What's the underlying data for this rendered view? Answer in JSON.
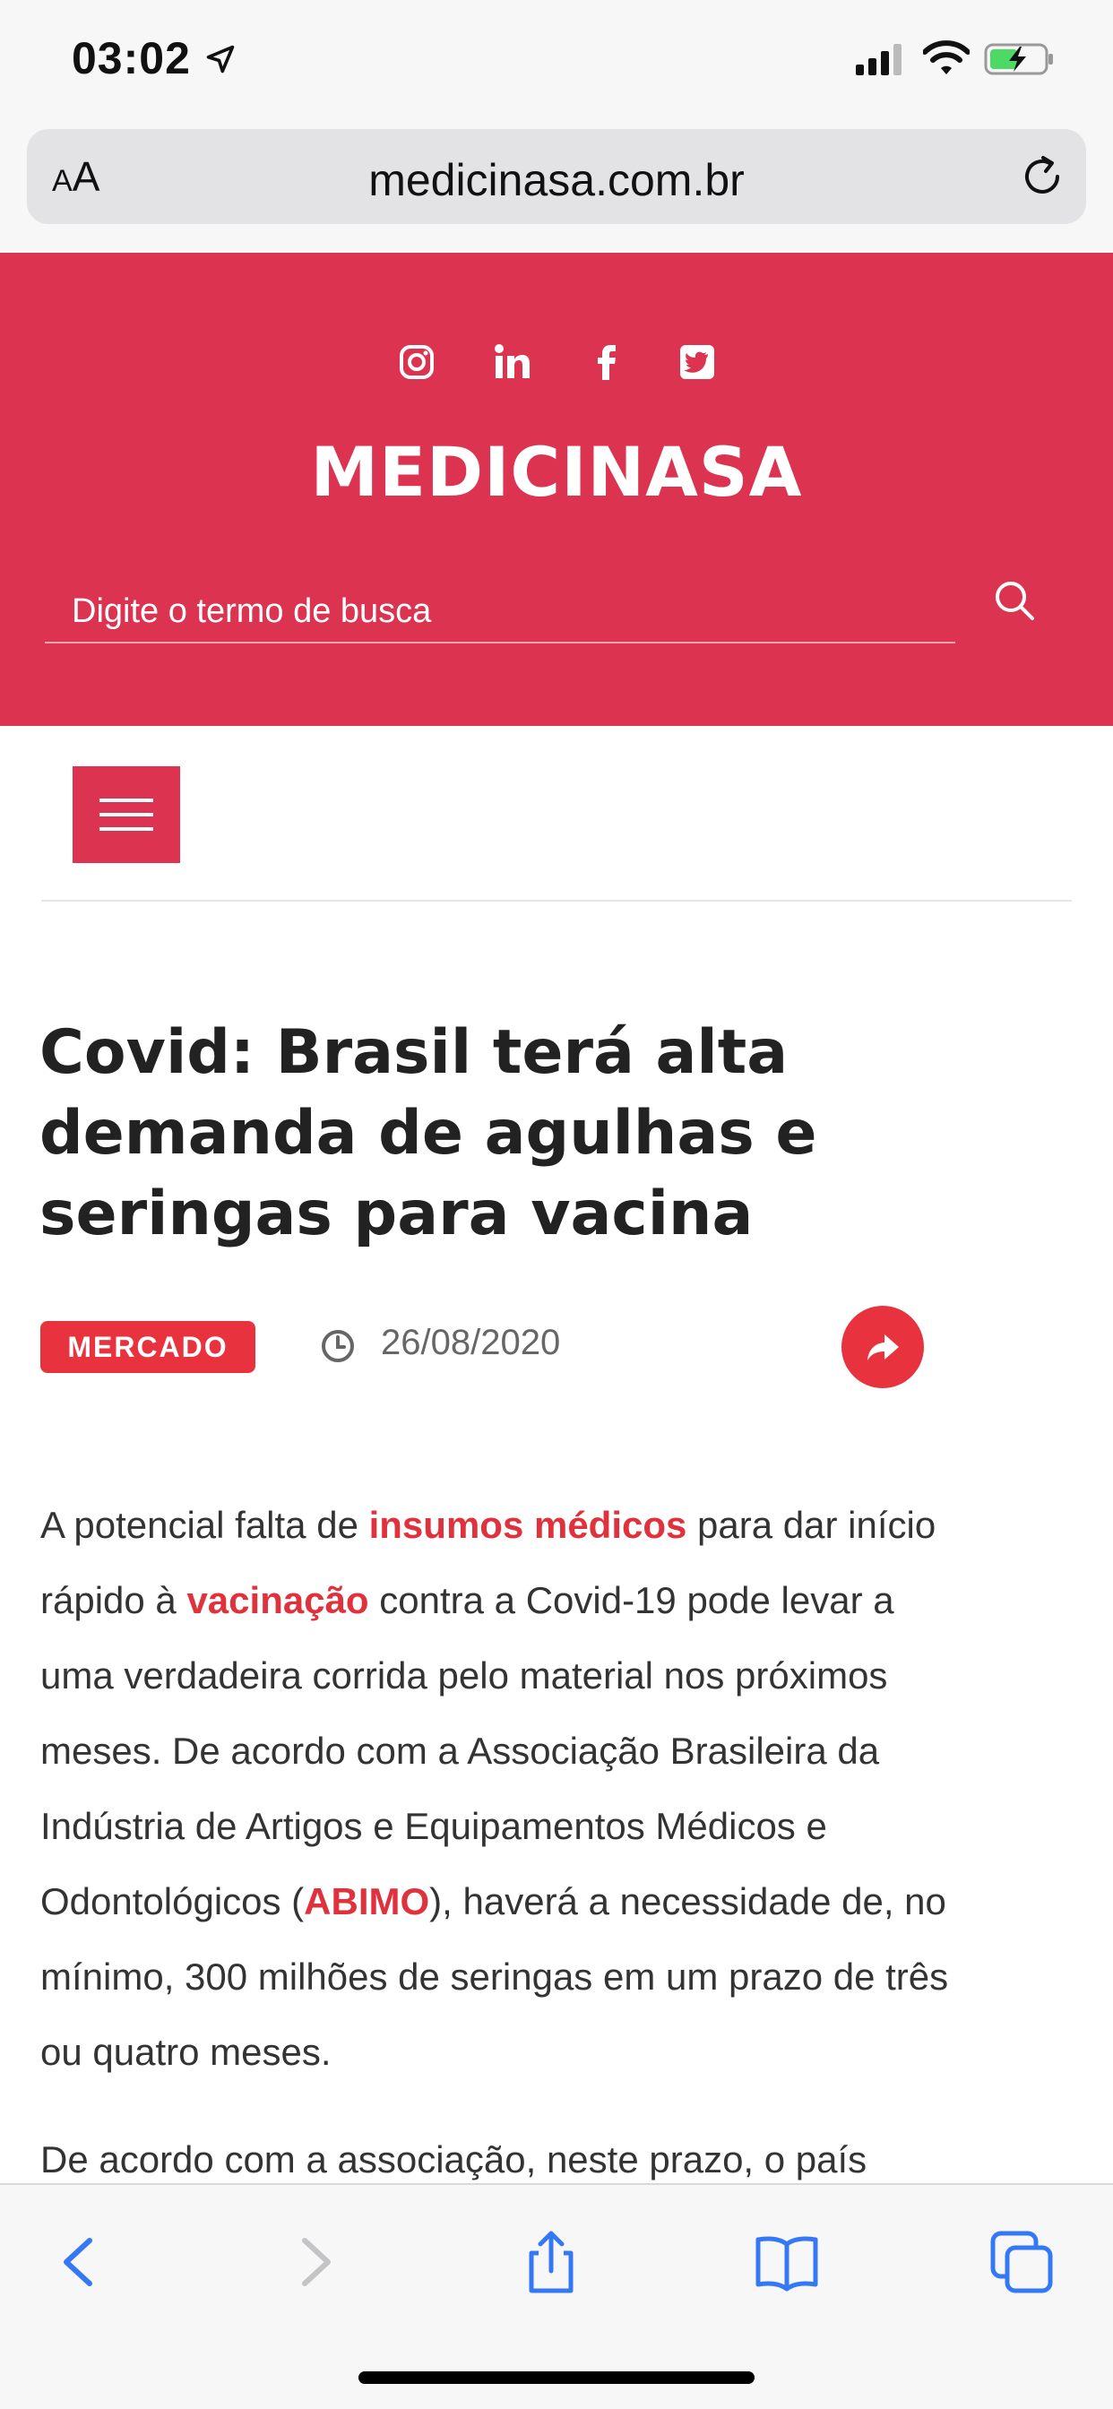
{
  "status_bar": {
    "time": "03:02",
    "icons": [
      "location-arrow-icon",
      "cellular-signal-icon",
      "wifi-icon",
      "battery-charging-icon"
    ]
  },
  "browser": {
    "text_size_label_small": "A",
    "text_size_label_large": "A",
    "url": "medicinasa.com.br",
    "reload_icon": "reload-icon"
  },
  "site": {
    "social_icons": [
      "instagram-icon",
      "linkedin-icon",
      "facebook-icon",
      "twitter-icon"
    ],
    "logo": "MEDICINASA",
    "search_placeholder": "Digite o termo de busca",
    "accent_color": "#dc3350"
  },
  "article": {
    "headline_lines": [
      "Covid: Brasil terá alta",
      "demanda de agulhas e",
      "seringas para vacina"
    ],
    "category": "MERCADO",
    "date": "26/08/2020",
    "paragraph1": {
      "p1": "A potencial falta de ",
      "link1": "insumos médicos",
      "p2": " para dar início rápido à ",
      "link2": "vacinação",
      "p3": " contra a Covid-19 pode levar a uma verdadeira corrida pelo material nos próximos meses. De acordo com a Associação Brasileira da Indústria de Artigos e Equipamentos Médicos e Odontológicos (",
      "link3": "ABIMO",
      "p4": "), haverá a necessidade de, no mínimo, 300 milhões de seringas em um prazo de três ou quatro meses."
    },
    "paragraph2_start": "De acordo com a associação, neste prazo, o país"
  },
  "toolbar": {
    "buttons": [
      "back-icon",
      "forward-icon",
      "share-icon",
      "bookmarks-icon",
      "tabs-icon"
    ]
  }
}
